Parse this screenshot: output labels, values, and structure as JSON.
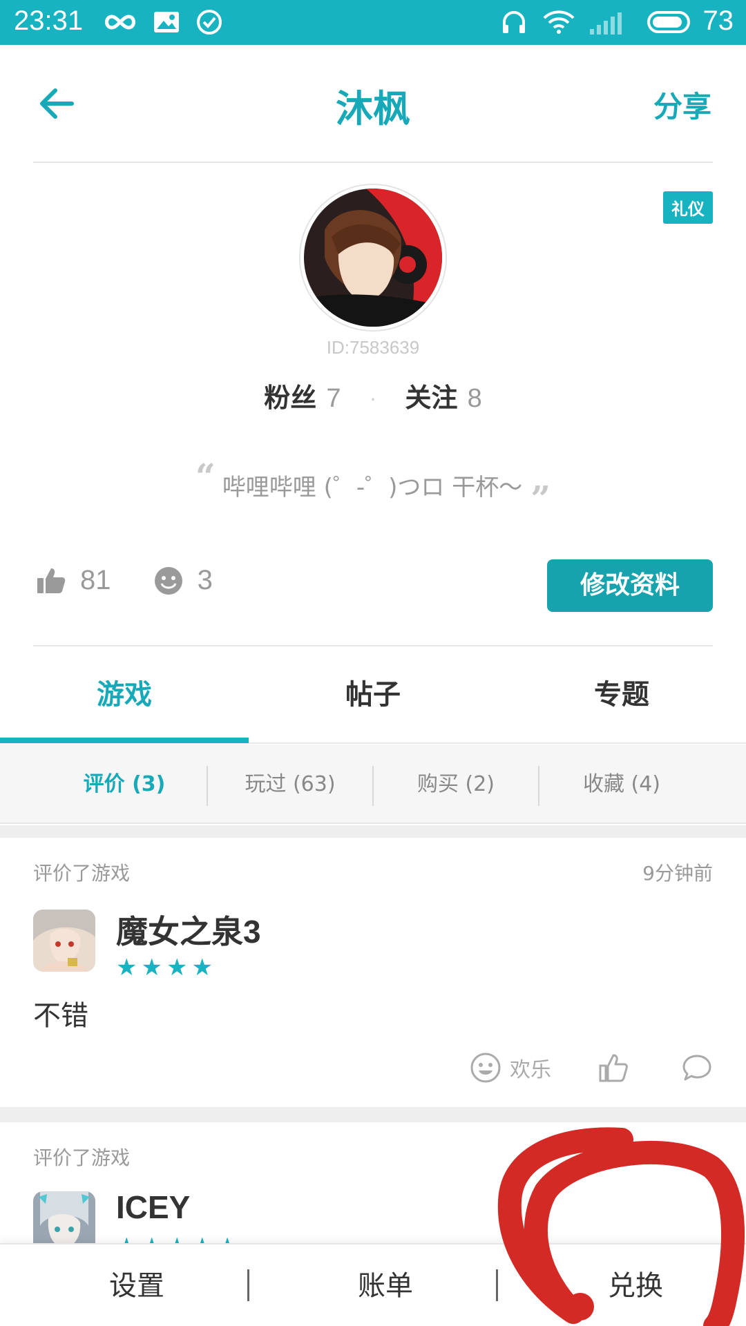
{
  "status_bar": {
    "time": "23:31",
    "battery": "73",
    "icons": [
      "infinity-icon",
      "image-icon",
      "check-circle-icon",
      "headphones-icon",
      "wifi-icon",
      "signal-icon",
      "battery-icon"
    ]
  },
  "header": {
    "title": "沐枫",
    "share_label": "分享",
    "back_icon": "back-arrow-icon"
  },
  "profile": {
    "badge": "礼仪",
    "id_text": "ID:7583639",
    "fans_label": "粉丝",
    "fans_count": "7",
    "follow_label": "关注",
    "follow_count": "8",
    "dot": "·",
    "bio": "哔哩哔哩 (゜-゜)つロ 干杯～",
    "bio_open_quote": "“",
    "bio_close_quote": "”",
    "likes": "81",
    "smiles": "3",
    "edit_label": "修改资料"
  },
  "tabs": [
    {
      "label": "游戏",
      "active": true
    },
    {
      "label": "帖子",
      "active": false
    },
    {
      "label": "专题",
      "active": false
    }
  ],
  "subtabs": [
    {
      "label": "评价 (3)",
      "active": true
    },
    {
      "label": "玩过 (63)",
      "active": false
    },
    {
      "label": "购买 (2)",
      "active": false
    },
    {
      "label": "收藏 (4)",
      "active": false
    }
  ],
  "reviews": [
    {
      "meta": "评价了游戏",
      "time": "9分钟前",
      "game": "魔女之泉3",
      "stars": "★★★★",
      "comment": "不错",
      "mood": "欢乐"
    },
    {
      "meta": "评价了游戏",
      "game": "ICEY",
      "stars": "★★★★★"
    }
  ],
  "bottom_bar": [
    "设置",
    "账单",
    "兑换"
  ],
  "colors": {
    "accent": "#17b3c1",
    "accent_dark": "#17a3ad",
    "annotation_red": "#d32a25"
  }
}
